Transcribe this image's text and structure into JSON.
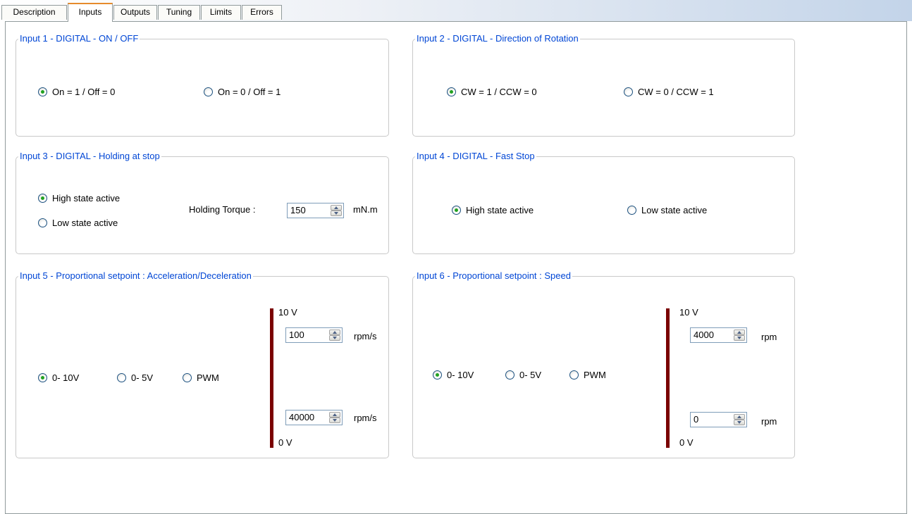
{
  "tabs": [
    "Description",
    "Inputs",
    "Outputs",
    "Tuning",
    "Limits",
    "Errors"
  ],
  "active_tab": "Inputs",
  "input1": {
    "title": "Input 1 - DIGITAL - ON / OFF",
    "options": [
      "On = 1 / Off = 0",
      "On = 0 / Off = 1"
    ],
    "selected": "On = 1 / Off = 0"
  },
  "input2": {
    "title": "Input 2 - DIGITAL - Direction of Rotation",
    "options": [
      "CW = 1 / CCW = 0",
      "CW = 0 / CCW = 1"
    ],
    "selected": "CW = 1 / CCW = 0"
  },
  "input3": {
    "title": "Input 3 - DIGITAL - Holding at stop",
    "options": [
      "High state active",
      "Low state active"
    ],
    "selected": "High state active",
    "torque_label": "Holding Torque :",
    "torque_value": "150",
    "torque_unit": "mN.m"
  },
  "input4": {
    "title": "Input 4 - DIGITAL - Fast Stop",
    "options": [
      "High state active",
      "Low state active"
    ],
    "selected": "High state active"
  },
  "input5": {
    "title": "Input 5 - Proportional setpoint : Acceleration/Deceleration",
    "options": [
      "0- 10V",
      "0- 5V",
      "PWM"
    ],
    "selected": "0- 10V",
    "top_label": "10 V",
    "bottom_label": "0 V",
    "high_value": "100",
    "low_value": "40000",
    "unit": "rpm/s",
    "bar_color": "#7a0000"
  },
  "input6": {
    "title": "Input 6 - Proportional setpoint : Speed",
    "options": [
      "0- 10V",
      "0- 5V",
      "PWM"
    ],
    "selected": "0- 10V",
    "top_label": "10 V",
    "bottom_label": "0 V",
    "high_value": "4000",
    "low_value": "0",
    "unit": "rpm",
    "bar_color": "#7a0000"
  },
  "colors": {
    "legend": "#0046d5",
    "active_tab_accent": "#e68b2c",
    "radio_dot": "#21a121"
  }
}
